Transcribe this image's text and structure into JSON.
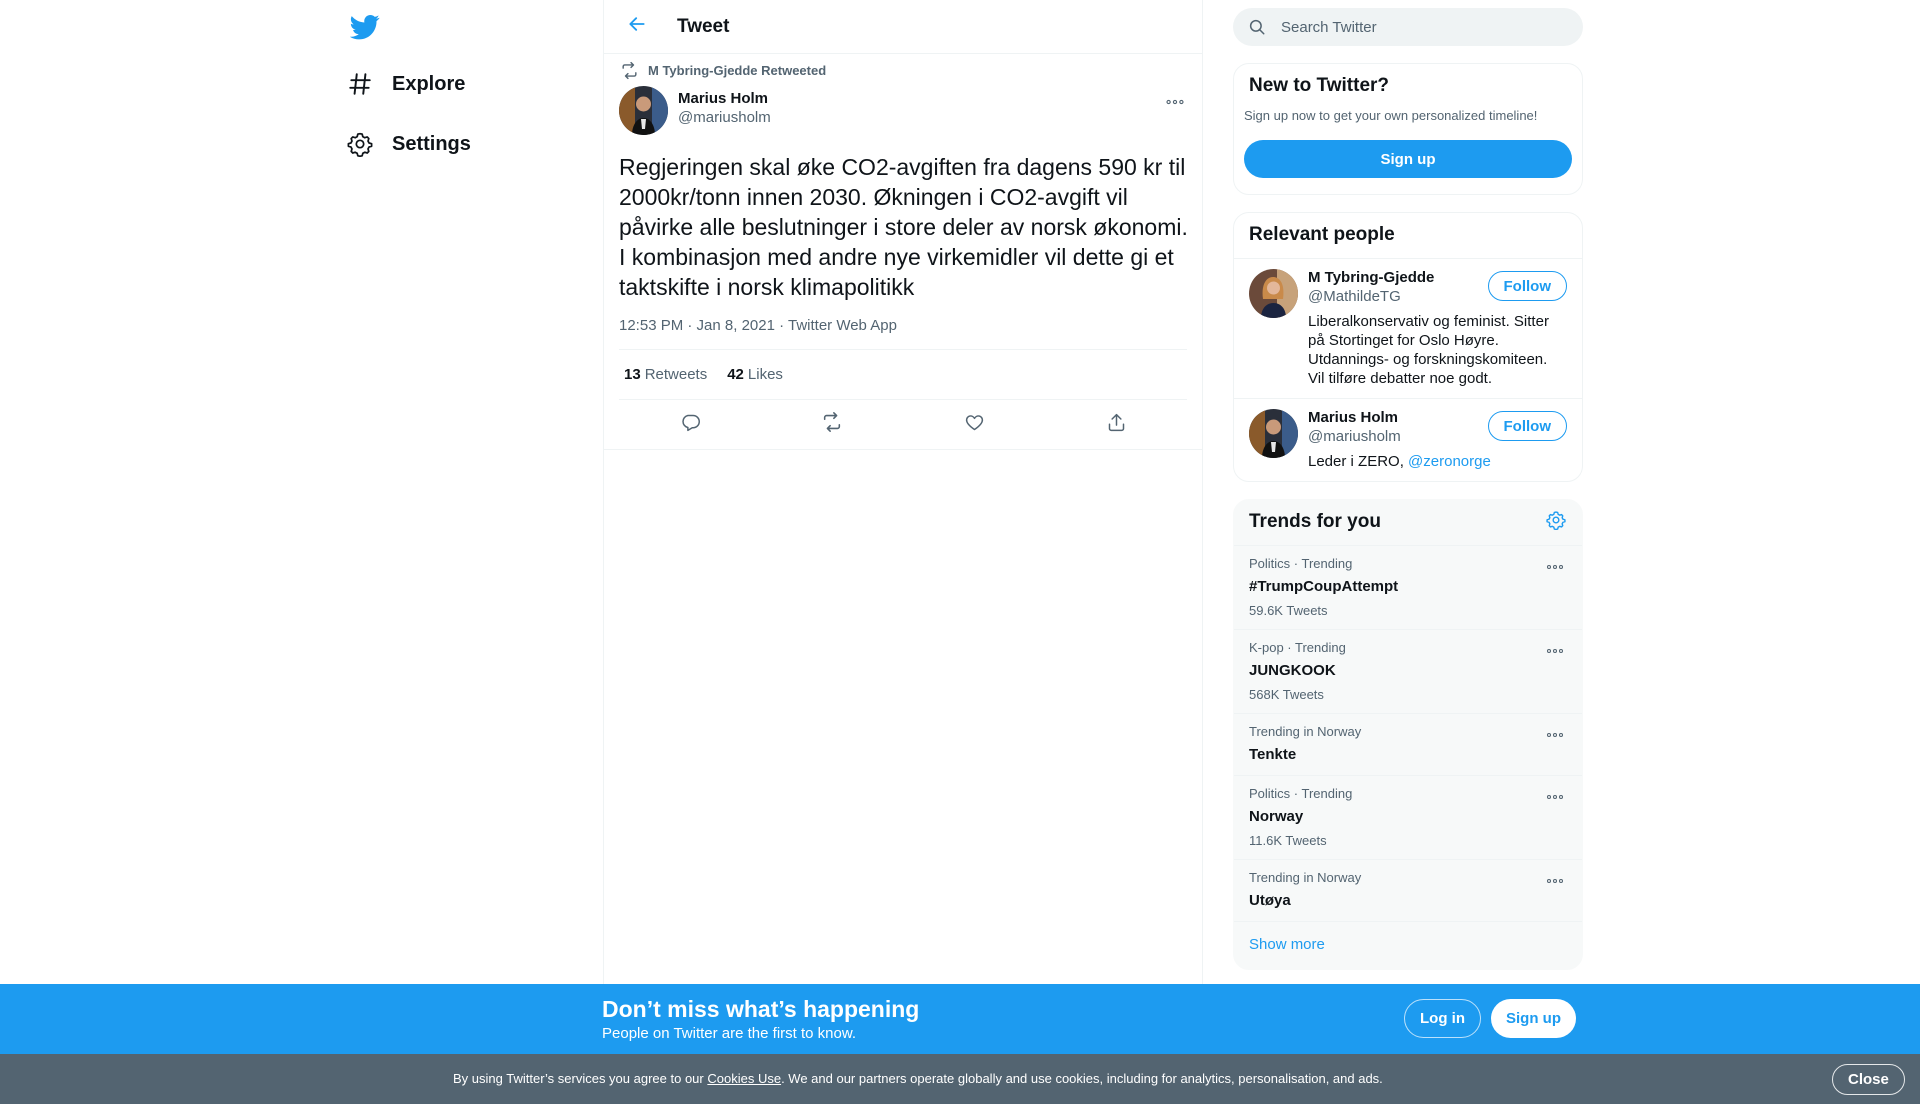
{
  "nav": {
    "items": [
      {
        "label": "Explore",
        "icon": "hashtag-icon"
      },
      {
        "label": "Settings",
        "icon": "gear-icon"
      }
    ]
  },
  "main": {
    "title": "Tweet"
  },
  "tweet": {
    "retweeted_by": "M Tybring-Gjedde Retweeted",
    "author_name": "Marius Holm",
    "author_handle": "@mariusholm",
    "text": "Regjeringen skal øke CO2-avgiften fra dagens 590 kr til 2000kr/tonn innen 2030. Økningen i CO2-avgift vil påvirke alle beslutninger i store deler av norsk økonomi. I kombinasjon med andre nye virkemidler vil dette gi et taktskifte i norsk klimapolitikk",
    "meta": "12:53 PM · Jan 8, 2021 · Twitter Web App",
    "retweets_count": "13",
    "retweets_label": "Retweets",
    "likes_count": "42",
    "likes_label": "Likes"
  },
  "search": {
    "placeholder": "Search Twitter"
  },
  "new_to_twitter": {
    "title": "New to Twitter?",
    "subtitle": "Sign up now to get your own personalized timeline!",
    "signup_label": "Sign up"
  },
  "relevant_people": {
    "title": "Relevant people",
    "people": [
      {
        "name": "M Tybring-Gjedde",
        "handle": "@MathildeTG",
        "follow_label": "Follow",
        "bio": "Liberalkonservativ og feminist. Sitter på Stortinget for Oslo Høyre. Utdannings- og forskningskomiteen. Vil tilføre debatter noe godt."
      },
      {
        "name": "Marius Holm",
        "handle": "@mariusholm",
        "follow_label": "Follow",
        "bio": "Leder i ZERO, ",
        "bio_mention": "@zeronorge"
      }
    ]
  },
  "trends": {
    "title": "Trends for you",
    "items": [
      {
        "context": "Politics · Trending",
        "name": "#TrumpCoupAttempt",
        "count": "59.6K Tweets"
      },
      {
        "context": "K-pop · Trending",
        "name": "JUNGKOOK",
        "count": "568K Tweets"
      },
      {
        "context": "Trending in Norway",
        "name": "Tenkte"
      },
      {
        "context": "Politics · Trending",
        "name": "Norway",
        "count": "11.6K Tweets"
      },
      {
        "context": "Trending in Norway",
        "name": "Utøya"
      }
    ],
    "show_more": "Show more"
  },
  "bottom_bar": {
    "title": "Don’t miss what’s happening",
    "subtitle": "People on Twitter are the first to know.",
    "login_label": "Log in",
    "signup_label": "Sign up"
  },
  "cookie_bar": {
    "text_before": "By using Twitter’s services you agree to our ",
    "link": "Cookies Use",
    "text_after": ". We and our partners operate globally and use cookies, including for analytics, personalisation, and ads.",
    "close_label": "Close"
  },
  "colors": {
    "accent": "#1d9bf0",
    "text_primary": "#0f1419",
    "text_secondary": "#536471",
    "cookie_bar_bg": "#536471"
  }
}
